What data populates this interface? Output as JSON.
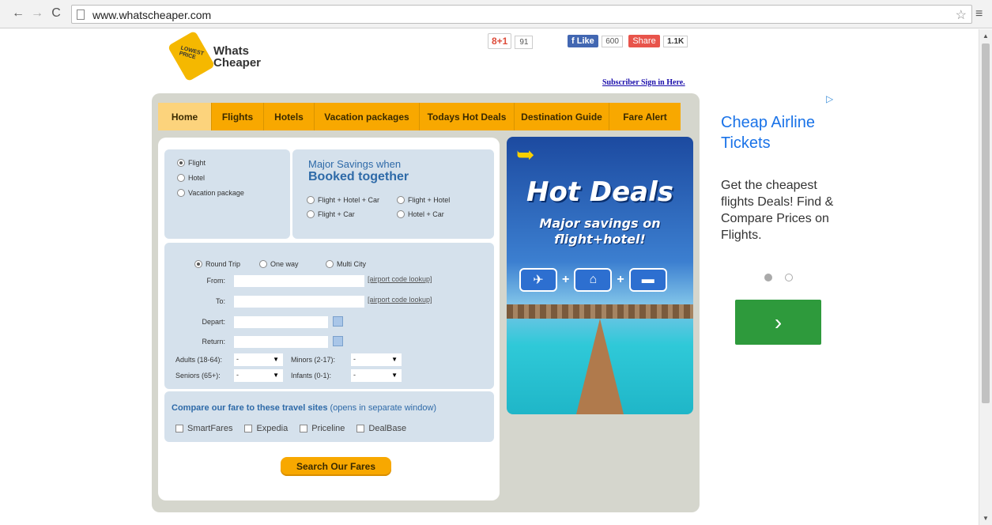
{
  "browser": {
    "url": "www.whatscheaper.com"
  },
  "header": {
    "logo_text": "Whats Cheaper",
    "logo_tag": "LOWEST PRICE",
    "gplus_label": "8+1",
    "gplus_count": "91",
    "fb_like_label": "Like",
    "fb_like_count": "600",
    "fb_share_label": "Share",
    "fb_share_count": "1.1K",
    "subscriber_link": "Subscriber Sign in Here."
  },
  "nav": {
    "tabs": [
      {
        "label": "Home"
      },
      {
        "label": "Flights"
      },
      {
        "label": "Hotels"
      },
      {
        "label": "Vacation packages"
      },
      {
        "label": "Todays Hot Deals"
      },
      {
        "label": "Destination Guide"
      },
      {
        "label": "Fare Alert"
      }
    ]
  },
  "search_type": {
    "options": [
      "Flight",
      "Hotel",
      "Vacation package"
    ],
    "selected": "Flight"
  },
  "bundle": {
    "line1": "Major Savings when",
    "line2": "Booked together",
    "options": [
      "Flight + Hotel + Car",
      "Flight + Hotel",
      "Flight + Car",
      "Hotel + Car"
    ]
  },
  "flight_form": {
    "trip_types": [
      "Round Trip",
      "One way",
      "Multi City"
    ],
    "selected_trip": "Round Trip",
    "from_label": "From:",
    "to_label": "To:",
    "depart_label": "Depart:",
    "return_label": "Return:",
    "lookup_link": "[airport code lookup]",
    "adults_label": "Adults (18-64):",
    "minors_label": "Minors (2-17):",
    "seniors_label": "Seniors (65+):",
    "infants_label": "Infants (0-1):",
    "select_value": "-"
  },
  "compare": {
    "title": "Compare our fare to these travel sites",
    "subtitle": "(opens in separate window)",
    "sites": [
      "SmartFares",
      "Expedia",
      "Priceline",
      "DealBase"
    ]
  },
  "search_button": "Search Our Fares",
  "promo": {
    "title": "Hot Deals",
    "subtitle_line1": "Major savings on",
    "subtitle_line2": "flight+hotel!"
  },
  "ad": {
    "title": "Cheap Airline Tickets",
    "body": "Get the cheapest flights Deals! Find & Compare Prices on Flights.",
    "next_label": "›"
  },
  "colors": {
    "tab_orange": "#f8a800",
    "panel_blue": "#d5e1ec",
    "outer_gray": "#d5d6cd",
    "ad_link": "#1a73e8",
    "ad_button": "#2e9a3c"
  }
}
